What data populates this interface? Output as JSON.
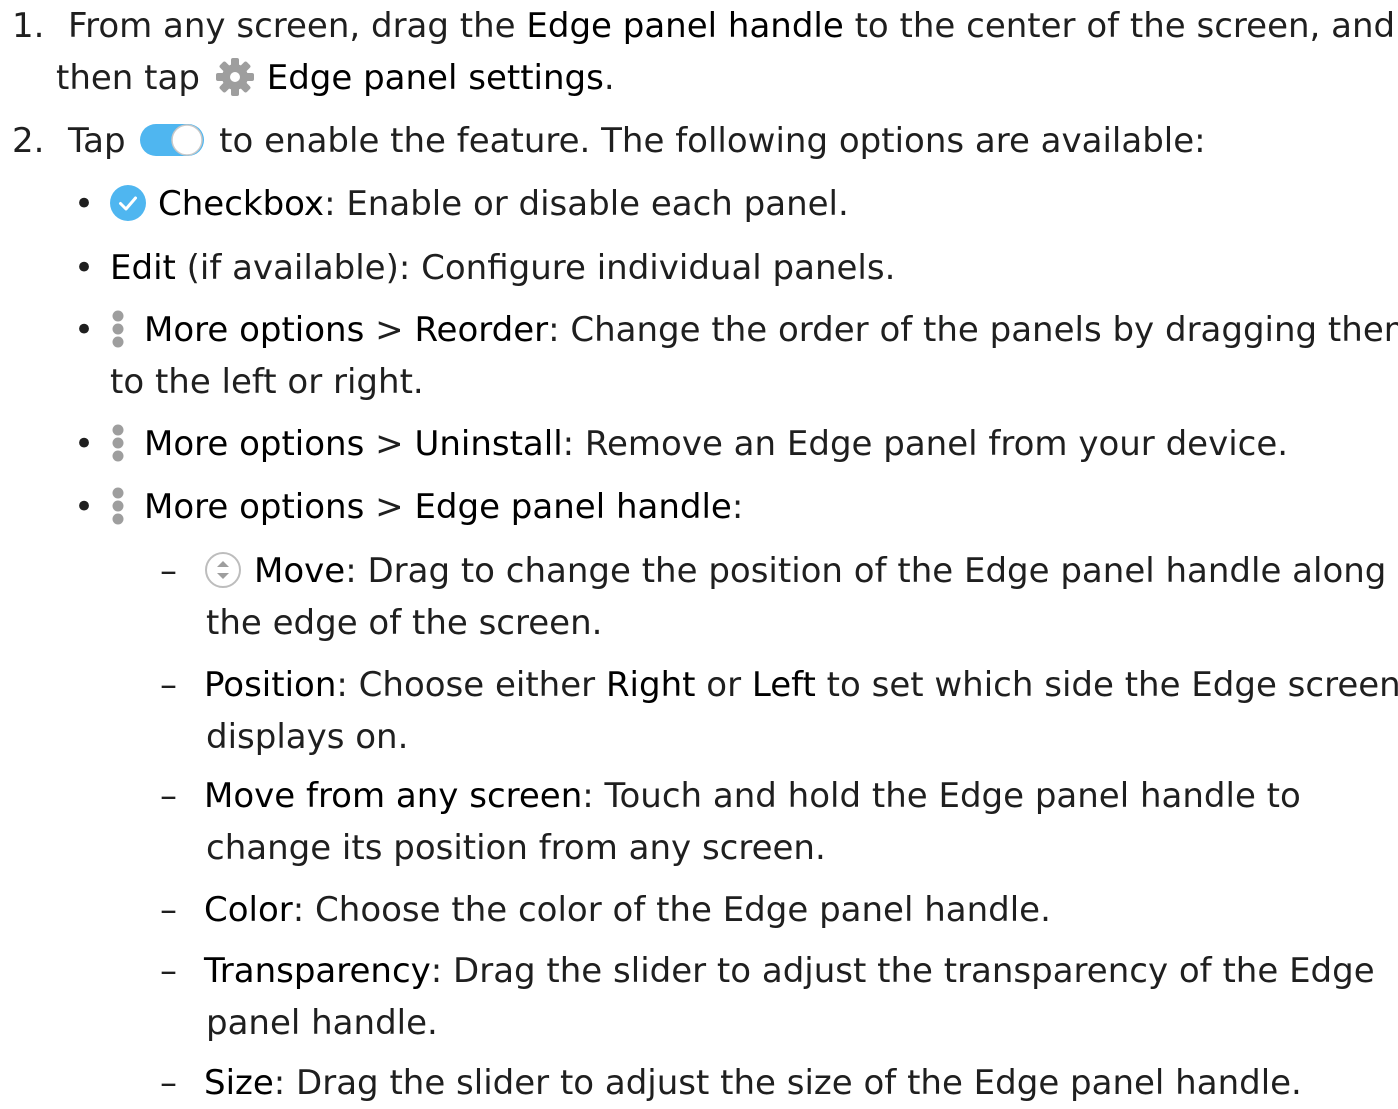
{
  "step1": {
    "num": "1.",
    "l1_a": "From any screen, drag the ",
    "l1_b": "Edge panel handle",
    "l1_c": " to the center of the screen, and",
    "l2_a": "then tap ",
    "l2_b": "Edge panel settings",
    "l2_c": "."
  },
  "step2": {
    "num": "2.",
    "a": "Tap ",
    "b": " to enable the feature. The following options are available:"
  },
  "bullets": {
    "checkbox": {
      "label": "Checkbox",
      "text": ": Enable or disable each panel."
    },
    "edit": {
      "label": "Edit",
      "text": " (if available): Configure individual panels."
    },
    "reorder": {
      "more": "More options",
      "sep": " > ",
      "label": "Reorder",
      "text": ": Change the order of the panels by dragging them",
      "text2": "to the left or right."
    },
    "uninstall": {
      "more": "More options",
      "sep": " > ",
      "label": "Uninstall",
      "text": ": Remove an Edge panel from your device."
    },
    "handle": {
      "more": "More options",
      "sep": " > ",
      "label": "Edge panel handle",
      "text": ":"
    }
  },
  "sub": {
    "move": {
      "label": "Move",
      "text": ": Drag to change the position of the Edge panel handle along",
      "text2": "the edge of the screen."
    },
    "position": {
      "label": "Position",
      "a": ": Choose either ",
      "right": "Right",
      "or": " or ",
      "left": "Left",
      "b": " to set which side the Edge screen",
      "text2": "displays on."
    },
    "mfas": {
      "label": "Move from any screen",
      "text": ": Touch and hold the Edge panel handle to",
      "text2": "change its position from any screen."
    },
    "color": {
      "label": "Color",
      "text": ": Choose the color of the Edge panel handle."
    },
    "transparency": {
      "label": "Transparency",
      "text": ": Drag the slider to adjust the transparency of the Edge",
      "text2": "panel handle."
    },
    "size": {
      "label": "Size",
      "text": ": Drag the slider to adjust the size of the Edge panel handle."
    }
  },
  "icons": {
    "gear": "gear-icon",
    "toggle": "toggle-icon",
    "check": "checkbox-icon",
    "dots": "more-options-icon",
    "move": "move-icon"
  },
  "colors": {
    "accent": "#4fb6f0",
    "icon_grey": "#9e9e9e"
  }
}
